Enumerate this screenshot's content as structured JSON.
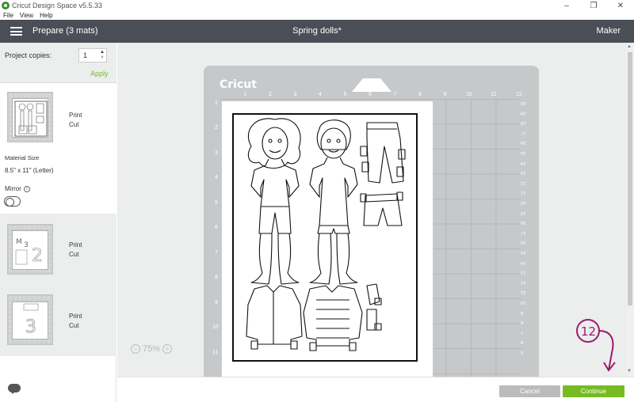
{
  "window": {
    "title": "Cricut Design Space   v5.5.33",
    "controls": [
      "–",
      "❐",
      "✕"
    ]
  },
  "menu": [
    "File",
    "View",
    "Help"
  ],
  "header": {
    "prepare_title": "Prepare (3 mats)",
    "project_title": "Spring dolls*",
    "machine": "Maker"
  },
  "left_panel": {
    "copies_label": "Project copies:",
    "copies_value": "1",
    "apply_label": "Apply",
    "material_size_label": "Material Size",
    "material_size_value": "8.5\" x 11\" (Letter)",
    "mirror_label": "Mirror",
    "mats": [
      {
        "mode_1": "Print",
        "mode_2": "Cut",
        "selected": true
      },
      {
        "mode_1": "Print",
        "mode_2": "Cut",
        "selected": false
      },
      {
        "mode_1": "Print",
        "mode_2": "Cut",
        "selected": false
      }
    ]
  },
  "mat": {
    "logo": "Cricut",
    "ruler_top": [
      "1",
      "2",
      "3",
      "4",
      "5",
      "6",
      "7",
      "8",
      "9",
      "10",
      "11",
      "12"
    ],
    "ruler_left": [
      "1",
      "2",
      "3",
      "4",
      "5",
      "6",
      "7",
      "8",
      "9",
      "10",
      "11"
    ],
    "ruler_right": [
      "30",
      "29",
      "28",
      "27",
      "26",
      "25",
      "24",
      "23",
      "22",
      "21",
      "20",
      "19",
      "18",
      "17",
      "16",
      "15",
      "14",
      "13",
      "12",
      "11",
      "10",
      "9",
      "8",
      "7",
      "6",
      "5"
    ]
  },
  "zoom": {
    "minus": "−",
    "value": "75%",
    "plus": "+"
  },
  "footer": {
    "cancel_label": "Cancel",
    "continue_label": "Continue"
  },
  "annotation": {
    "text": "12"
  }
}
